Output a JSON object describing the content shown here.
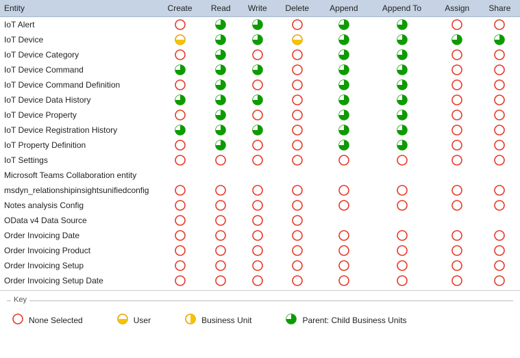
{
  "headers": [
    "Entity",
    "Create",
    "Read",
    "Write",
    "Delete",
    "Append",
    "Append To",
    "Assign",
    "Share"
  ],
  "rows": [
    {
      "entity": "IoT Alert",
      "perms": [
        "none",
        "pcbu",
        "pcbu",
        "none",
        "pcbu",
        "pcbu",
        "none",
        "none"
      ]
    },
    {
      "entity": "IoT Device",
      "perms": [
        "user",
        "pcbu",
        "pcbu",
        "user",
        "pcbu",
        "pcbu",
        "pcbu",
        "pcbu"
      ]
    },
    {
      "entity": "IoT Device Category",
      "perms": [
        "none",
        "pcbu",
        "none",
        "none",
        "pcbu",
        "pcbu",
        "none",
        "none"
      ]
    },
    {
      "entity": "IoT Device Command",
      "perms": [
        "pcbu",
        "pcbu",
        "pcbu",
        "none",
        "pcbu",
        "pcbu",
        "none",
        "none"
      ]
    },
    {
      "entity": "IoT Device Command Definition",
      "perms": [
        "none",
        "pcbu",
        "none",
        "none",
        "pcbu",
        "pcbu",
        "none",
        "none"
      ]
    },
    {
      "entity": "IoT Device Data History",
      "perms": [
        "pcbu",
        "pcbu",
        "pcbu",
        "none",
        "pcbu",
        "pcbu",
        "none",
        "none"
      ]
    },
    {
      "entity": "IoT Device Property",
      "perms": [
        "none",
        "pcbu",
        "none",
        "none",
        "pcbu",
        "pcbu",
        "none",
        "none"
      ]
    },
    {
      "entity": "IoT Device Registration History",
      "perms": [
        "pcbu",
        "pcbu",
        "pcbu",
        "none",
        "pcbu",
        "pcbu",
        "none",
        "none"
      ]
    },
    {
      "entity": "IoT Property Definition",
      "perms": [
        "none",
        "pcbu",
        "none",
        "none",
        "pcbu",
        "pcbu",
        "none",
        "none"
      ]
    },
    {
      "entity": "IoT Settings",
      "perms": [
        "none",
        "none",
        "none",
        "none",
        "none",
        "none",
        "none",
        "none"
      ]
    },
    {
      "entity": "Microsoft Teams Collaboration entity",
      "perms": [
        "",
        "",
        "",
        "",
        "",
        "",
        "",
        ""
      ]
    },
    {
      "entity": "msdyn_relationshipinsightsunifiedconfig",
      "perms": [
        "none",
        "none",
        "none",
        "none",
        "none",
        "none",
        "none",
        "none"
      ]
    },
    {
      "entity": "Notes analysis Config",
      "perms": [
        "none",
        "none",
        "none",
        "none",
        "none",
        "none",
        "none",
        "none"
      ]
    },
    {
      "entity": "OData v4 Data Source",
      "perms": [
        "none",
        "none",
        "none",
        "none",
        "",
        "",
        "",
        ""
      ]
    },
    {
      "entity": "Order Invoicing Date",
      "perms": [
        "none",
        "none",
        "none",
        "none",
        "none",
        "none",
        "none",
        "none"
      ]
    },
    {
      "entity": "Order Invoicing Product",
      "perms": [
        "none",
        "none",
        "none",
        "none",
        "none",
        "none",
        "none",
        "none"
      ]
    },
    {
      "entity": "Order Invoicing Setup",
      "perms": [
        "none",
        "none",
        "none",
        "none",
        "none",
        "none",
        "none",
        "none"
      ]
    },
    {
      "entity": "Order Invoicing Setup Date",
      "perms": [
        "none",
        "none",
        "none",
        "none",
        "none",
        "none",
        "none",
        "none"
      ]
    }
  ],
  "legend": {
    "title": "Key",
    "items": [
      {
        "type": "none",
        "label": "None Selected"
      },
      {
        "type": "user",
        "label": "User"
      },
      {
        "type": "bu",
        "label": "Business Unit"
      },
      {
        "type": "pcbu",
        "label": "Parent: Child Business Units"
      }
    ]
  },
  "chart_data": {
    "type": "table",
    "title": "Security Role Entity Permissions",
    "columns": [
      "Entity",
      "Create",
      "Read",
      "Write",
      "Delete",
      "Append",
      "Append To",
      "Assign",
      "Share"
    ],
    "value_legend": {
      "none": "None Selected",
      "user": "User",
      "bu": "Business Unit",
      "pcbu": "Parent: Child Business Units",
      "": "not applicable / blank"
    },
    "rows": [
      [
        "IoT Alert",
        "none",
        "pcbu",
        "pcbu",
        "none",
        "pcbu",
        "pcbu",
        "none",
        "none"
      ],
      [
        "IoT Device",
        "user",
        "pcbu",
        "pcbu",
        "user",
        "pcbu",
        "pcbu",
        "pcbu",
        "pcbu"
      ],
      [
        "IoT Device Category",
        "none",
        "pcbu",
        "none",
        "none",
        "pcbu",
        "pcbu",
        "none",
        "none"
      ],
      [
        "IoT Device Command",
        "pcbu",
        "pcbu",
        "pcbu",
        "none",
        "pcbu",
        "pcbu",
        "none",
        "none"
      ],
      [
        "IoT Device Command Definition",
        "none",
        "pcbu",
        "none",
        "none",
        "pcbu",
        "pcbu",
        "none",
        "none"
      ],
      [
        "IoT Device Data History",
        "pcbu",
        "pcbu",
        "pcbu",
        "none",
        "pcbu",
        "pcbu",
        "none",
        "none"
      ],
      [
        "IoT Device Property",
        "none",
        "pcbu",
        "none",
        "none",
        "pcbu",
        "pcbu",
        "none",
        "none"
      ],
      [
        "IoT Device Registration History",
        "pcbu",
        "pcbu",
        "pcbu",
        "none",
        "pcbu",
        "pcbu",
        "none",
        "none"
      ],
      [
        "IoT Property Definition",
        "none",
        "pcbu",
        "none",
        "none",
        "pcbu",
        "pcbu",
        "none",
        "none"
      ],
      [
        "IoT Settings",
        "none",
        "none",
        "none",
        "none",
        "none",
        "none",
        "none",
        "none"
      ],
      [
        "Microsoft Teams Collaboration entity",
        "",
        "",
        "",
        "",
        "",
        "",
        "",
        ""
      ],
      [
        "msdyn_relationshipinsightsunifiedconfig",
        "none",
        "none",
        "none",
        "none",
        "none",
        "none",
        "none",
        "none"
      ],
      [
        "Notes analysis Config",
        "none",
        "none",
        "none",
        "none",
        "none",
        "none",
        "none",
        "none"
      ],
      [
        "OData v4 Data Source",
        "none",
        "none",
        "none",
        "none",
        "",
        "",
        "",
        ""
      ],
      [
        "Order Invoicing Date",
        "none",
        "none",
        "none",
        "none",
        "none",
        "none",
        "none",
        "none"
      ],
      [
        "Order Invoicing Product",
        "none",
        "none",
        "none",
        "none",
        "none",
        "none",
        "none",
        "none"
      ],
      [
        "Order Invoicing Setup",
        "none",
        "none",
        "none",
        "none",
        "none",
        "none",
        "none",
        "none"
      ],
      [
        "Order Invoicing Setup Date",
        "none",
        "none",
        "none",
        "none",
        "none",
        "none",
        "none",
        "none"
      ]
    ]
  }
}
